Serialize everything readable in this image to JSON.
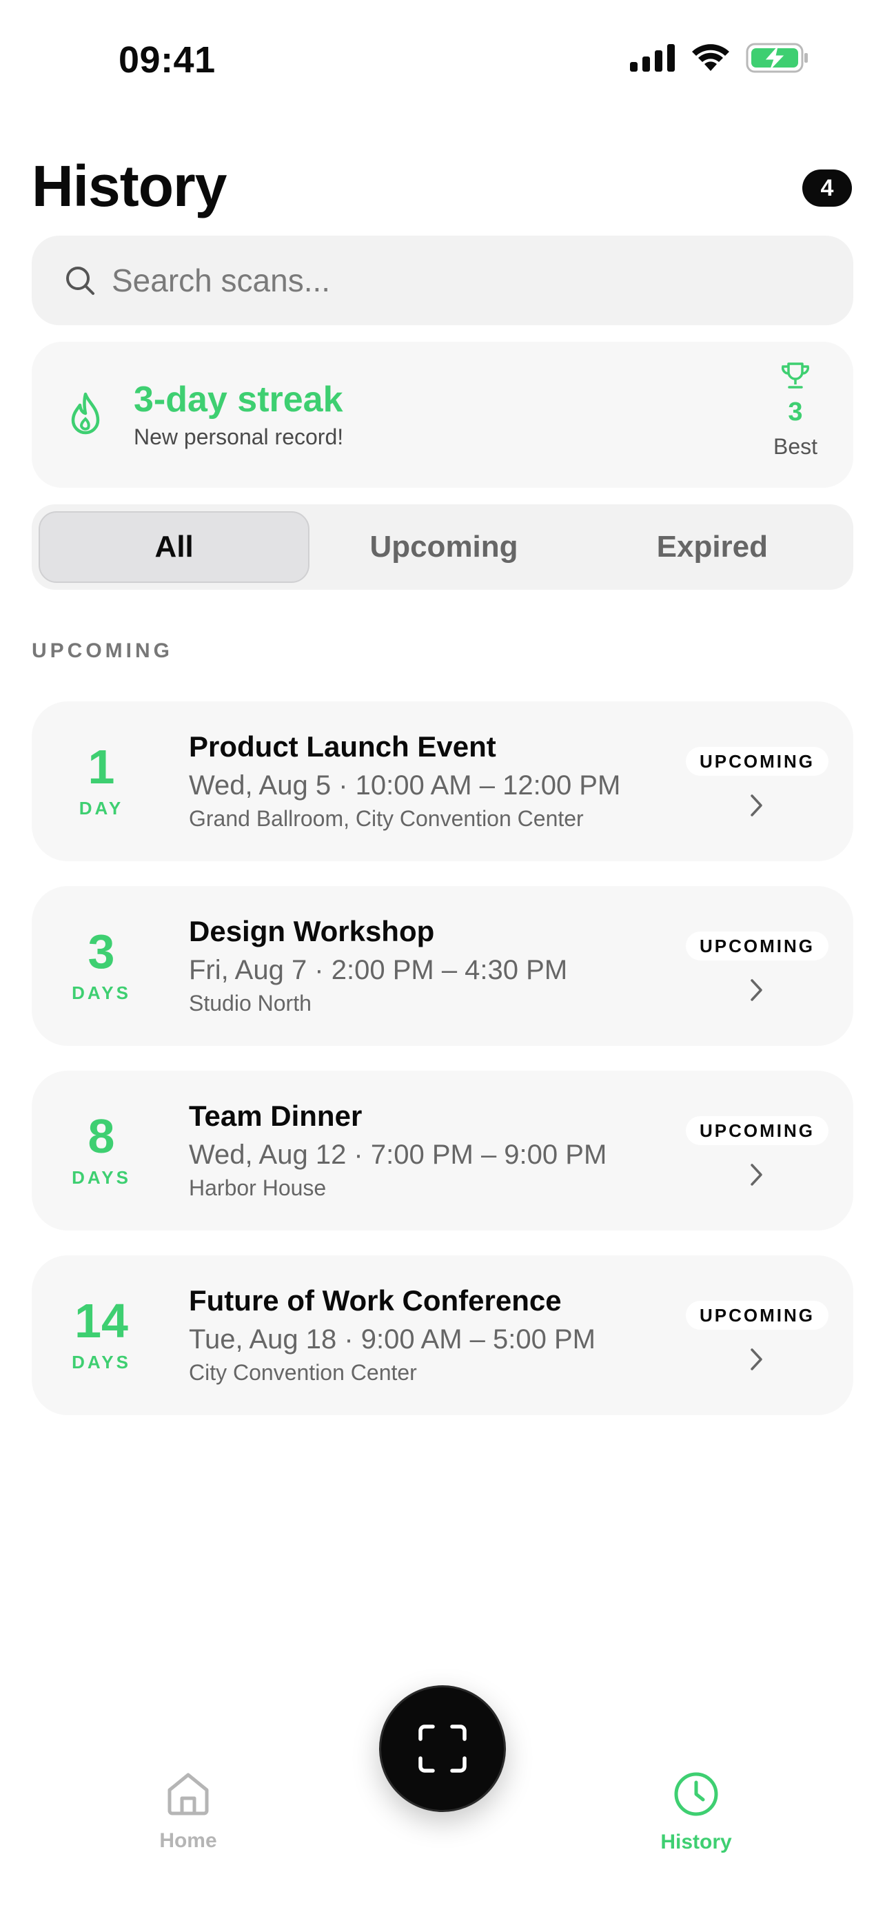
{
  "status_bar": {
    "time": "09:41"
  },
  "header": {
    "title": "History",
    "count": "4"
  },
  "search": {
    "placeholder": "Search scans..."
  },
  "streak": {
    "title": "3-day streak",
    "subtitle": "New personal record!",
    "best_value": "3",
    "best_label": "Best"
  },
  "tabs": [
    {
      "label": "All",
      "active": true
    },
    {
      "label": "Upcoming",
      "active": false
    },
    {
      "label": "Expired",
      "active": false
    }
  ],
  "section": {
    "label": "UPCOMING"
  },
  "events": [
    {
      "count": "1",
      "unit": "DAY",
      "title": "Product Launch Event",
      "time": "Wed, Aug 5 · 10:00 AM – 12:00 PM",
      "venue": "Grand Ballroom, City Convention Center",
      "badge": "UPCOMING"
    },
    {
      "count": "3",
      "unit": "DAYS",
      "title": "Design Workshop",
      "time": "Fri, Aug 7 · 2:00 PM – 4:30 PM",
      "venue": "Studio North",
      "badge": "UPCOMING"
    },
    {
      "count": "8",
      "unit": "DAYS",
      "title": "Team Dinner",
      "time": "Wed, Aug 12 · 7:00 PM – 9:00 PM",
      "venue": "Harbor House",
      "badge": "UPCOMING"
    },
    {
      "count": "14",
      "unit": "DAYS",
      "title": "Future of Work Conference",
      "time": "Tue, Aug 18 · 9:00 AM – 5:00 PM",
      "venue": "City Convention Center",
      "badge": "UPCOMING"
    }
  ],
  "nav": {
    "home_label": "Home",
    "history_label": "History",
    "active": "History"
  },
  "colors": {
    "accent": "#3ecf71",
    "text": "#0a0a0a",
    "muted": "#666666"
  }
}
